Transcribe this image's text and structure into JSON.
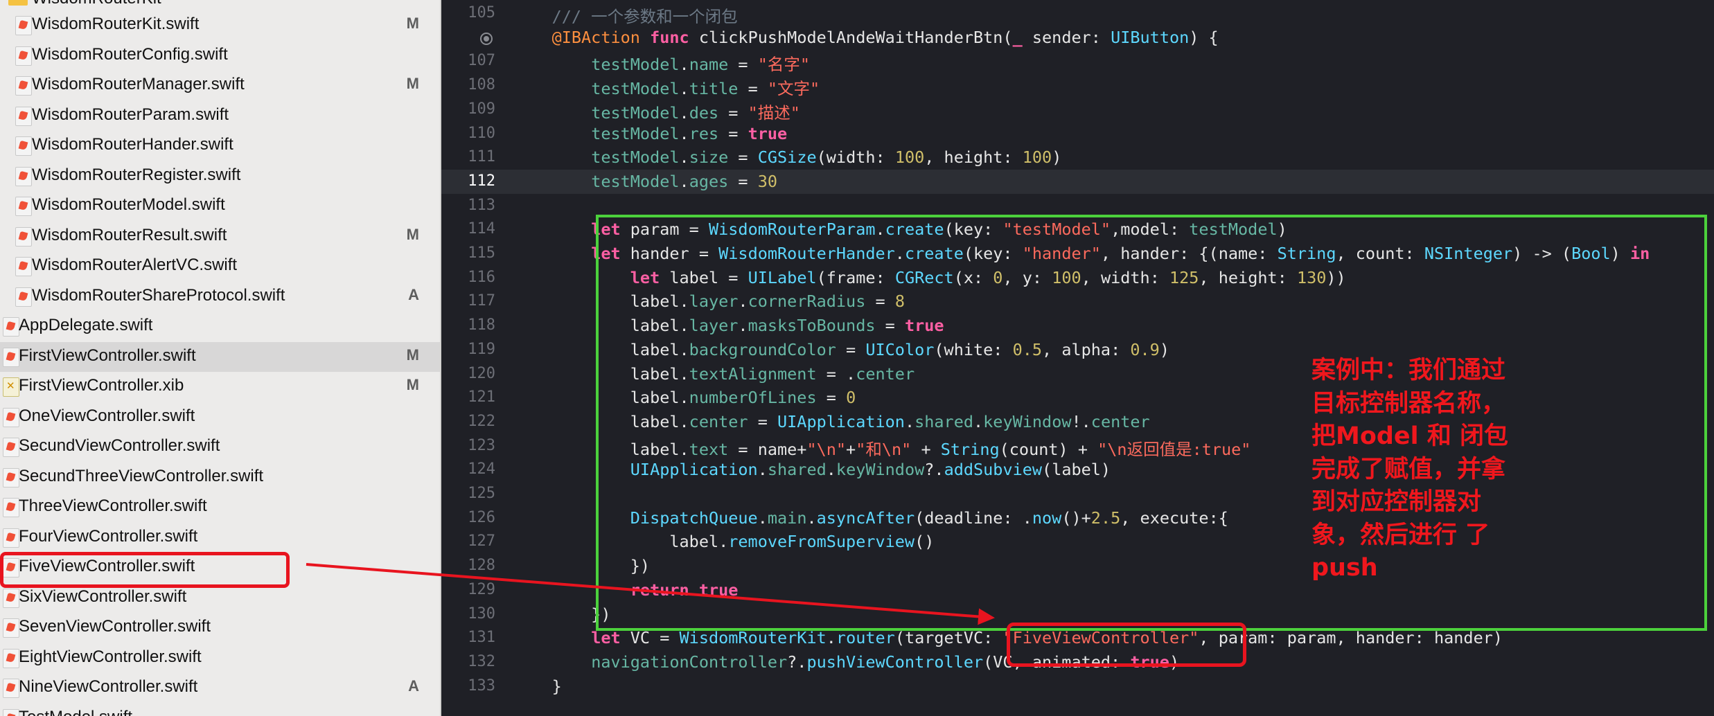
{
  "sidebar": {
    "folder_name": "WisdomRouterKit",
    "files": [
      {
        "name": "WisdomRouterKit.swift",
        "badge": "M",
        "type": "swift",
        "indent": 1
      },
      {
        "name": "WisdomRouterConfig.swift",
        "badge": "",
        "type": "swift",
        "indent": 1
      },
      {
        "name": "WisdomRouterManager.swift",
        "badge": "M",
        "type": "swift",
        "indent": 1
      },
      {
        "name": "WisdomRouterParam.swift",
        "badge": "",
        "type": "swift",
        "indent": 1
      },
      {
        "name": "WisdomRouterHander.swift",
        "badge": "",
        "type": "swift",
        "indent": 1
      },
      {
        "name": "WisdomRouterRegister.swift",
        "badge": "",
        "type": "swift",
        "indent": 1
      },
      {
        "name": "WisdomRouterModel.swift",
        "badge": "",
        "type": "swift",
        "indent": 1
      },
      {
        "name": "WisdomRouterResult.swift",
        "badge": "M",
        "type": "swift",
        "indent": 1
      },
      {
        "name": "WisdomRouterAlertVC.swift",
        "badge": "",
        "type": "swift",
        "indent": 1
      },
      {
        "name": "WisdomRouterShareProtocol.swift",
        "badge": "A",
        "type": "swift",
        "indent": 1
      },
      {
        "name": "AppDelegate.swift",
        "badge": "",
        "type": "swift",
        "indent": 0
      },
      {
        "name": "FirstViewController.swift",
        "badge": "M",
        "type": "swift",
        "indent": 0,
        "selected": true
      },
      {
        "name": "FirstViewController.xib",
        "badge": "M",
        "type": "xib",
        "indent": 0
      },
      {
        "name": "OneViewController.swift",
        "badge": "",
        "type": "swift",
        "indent": 0
      },
      {
        "name": "SecundViewController.swift",
        "badge": "",
        "type": "swift",
        "indent": 0
      },
      {
        "name": "SecundThreeViewController.swift",
        "badge": "",
        "type": "swift",
        "indent": 0
      },
      {
        "name": "ThreeViewController.swift",
        "badge": "",
        "type": "swift",
        "indent": 0
      },
      {
        "name": "FourViewController.swift",
        "badge": "",
        "type": "swift",
        "indent": 0
      },
      {
        "name": "FiveViewController.swift",
        "badge": "",
        "type": "swift",
        "indent": 0
      },
      {
        "name": "SixViewController.swift",
        "badge": "",
        "type": "swift",
        "indent": 0
      },
      {
        "name": "SevenViewController.swift",
        "badge": "",
        "type": "swift",
        "indent": 0
      },
      {
        "name": "EightViewController.swift",
        "badge": "",
        "type": "swift",
        "indent": 0
      },
      {
        "name": "NineViewController.swift",
        "badge": "A",
        "type": "swift",
        "indent": 0
      },
      {
        "name": "TestModel.swift",
        "badge": "",
        "type": "swift",
        "indent": 0
      }
    ]
  },
  "editor": {
    "current_line": 112,
    "lines": [
      {
        "n": "105",
        "t": [
          [
            "    ",
            ""
          ],
          [
            "/// 一个参数和一个闭包",
            "cm"
          ]
        ]
      },
      {
        "n": "",
        "bp": true,
        "t": [
          [
            "    ",
            ""
          ],
          [
            "@IBAction",
            "at"
          ],
          [
            " ",
            ""
          ],
          [
            "func",
            "kw"
          ],
          [
            " clickPushModelAndeWaitHanderBtn(",
            ""
          ],
          [
            "_",
            "kw"
          ],
          [
            " sender: ",
            ""
          ],
          [
            "UIButton",
            "ty"
          ],
          [
            ") {",
            ""
          ]
        ]
      },
      {
        "n": "107",
        "t": [
          [
            "        ",
            ""
          ],
          [
            "testModel",
            "pr"
          ],
          [
            ".",
            ""
          ],
          [
            "name",
            "pr"
          ],
          [
            " = ",
            ""
          ],
          [
            "\"名字\"",
            "st"
          ]
        ]
      },
      {
        "n": "108",
        "t": [
          [
            "        ",
            ""
          ],
          [
            "testModel",
            "pr"
          ],
          [
            ".",
            ""
          ],
          [
            "title",
            "pr"
          ],
          [
            " = ",
            ""
          ],
          [
            "\"文字\"",
            "st"
          ]
        ]
      },
      {
        "n": "109",
        "t": [
          [
            "        ",
            ""
          ],
          [
            "testModel",
            "pr"
          ],
          [
            ".",
            ""
          ],
          [
            "des",
            "pr"
          ],
          [
            " = ",
            ""
          ],
          [
            "\"描述\"",
            "st"
          ]
        ]
      },
      {
        "n": "110",
        "t": [
          [
            "        ",
            ""
          ],
          [
            "testModel",
            "pr"
          ],
          [
            ".",
            ""
          ],
          [
            "res",
            "pr"
          ],
          [
            " = ",
            ""
          ],
          [
            "true",
            "kw"
          ]
        ]
      },
      {
        "n": "111",
        "t": [
          [
            "        ",
            ""
          ],
          [
            "testModel",
            "pr"
          ],
          [
            ".",
            ""
          ],
          [
            "size",
            "pr"
          ],
          [
            " = ",
            ""
          ],
          [
            "CGSize",
            "ty"
          ],
          [
            "(width: ",
            ""
          ],
          [
            "100",
            "nm"
          ],
          [
            ", height: ",
            ""
          ],
          [
            "100",
            "nm"
          ],
          [
            ")",
            ""
          ]
        ]
      },
      {
        "n": "112",
        "t": [
          [
            "        ",
            ""
          ],
          [
            "testModel",
            "pr"
          ],
          [
            ".",
            ""
          ],
          [
            "ages",
            "pr"
          ],
          [
            " = ",
            ""
          ],
          [
            "30",
            "nm"
          ]
        ]
      },
      {
        "n": "113",
        "t": [
          [
            "",
            ""
          ]
        ]
      },
      {
        "n": "114",
        "t": [
          [
            "        ",
            ""
          ],
          [
            "let",
            "kw"
          ],
          [
            " param = ",
            ""
          ],
          [
            "WisdomRouterParam",
            "ty"
          ],
          [
            ".",
            ""
          ],
          [
            "create",
            "ty"
          ],
          [
            "(key: ",
            ""
          ],
          [
            "\"testModel\"",
            "st"
          ],
          [
            ",model: ",
            ""
          ],
          [
            "testModel",
            "pr"
          ],
          [
            ")",
            ""
          ]
        ]
      },
      {
        "n": "115",
        "t": [
          [
            "        ",
            ""
          ],
          [
            "let",
            "kw"
          ],
          [
            " hander = ",
            ""
          ],
          [
            "WisdomRouterHander",
            "ty"
          ],
          [
            ".",
            ""
          ],
          [
            "create",
            "ty"
          ],
          [
            "(key: ",
            ""
          ],
          [
            "\"hander\"",
            "st"
          ],
          [
            ", hander: {(name: ",
            ""
          ],
          [
            "String",
            "ty"
          ],
          [
            ", count: ",
            ""
          ],
          [
            "NSInteger",
            "ty"
          ],
          [
            ") -> (",
            ""
          ],
          [
            "Bool",
            "ty"
          ],
          [
            ") ",
            ""
          ],
          [
            "in",
            "kw"
          ]
        ]
      },
      {
        "n": "116",
        "t": [
          [
            "            ",
            ""
          ],
          [
            "let",
            "kw"
          ],
          [
            " label = ",
            ""
          ],
          [
            "UILabel",
            "ty"
          ],
          [
            "(frame: ",
            ""
          ],
          [
            "CGRect",
            "ty"
          ],
          [
            "(x: ",
            ""
          ],
          [
            "0",
            "nm"
          ],
          [
            ", y: ",
            ""
          ],
          [
            "100",
            "nm"
          ],
          [
            ", width: ",
            ""
          ],
          [
            "125",
            "nm"
          ],
          [
            ", height: ",
            ""
          ],
          [
            "130",
            "nm"
          ],
          [
            "))",
            ""
          ]
        ]
      },
      {
        "n": "117",
        "t": [
          [
            "            label.",
            ""
          ],
          [
            "layer",
            "pr"
          ],
          [
            ".",
            ""
          ],
          [
            "cornerRadius",
            "pr"
          ],
          [
            " = ",
            ""
          ],
          [
            "8",
            "nm"
          ]
        ]
      },
      {
        "n": "118",
        "t": [
          [
            "            label.",
            ""
          ],
          [
            "layer",
            "pr"
          ],
          [
            ".",
            ""
          ],
          [
            "masksToBounds",
            "pr"
          ],
          [
            " = ",
            ""
          ],
          [
            "true",
            "kw"
          ]
        ]
      },
      {
        "n": "119",
        "t": [
          [
            "            label.",
            ""
          ],
          [
            "backgroundColor",
            "pr"
          ],
          [
            " = ",
            ""
          ],
          [
            "UIColor",
            "ty"
          ],
          [
            "(white: ",
            ""
          ],
          [
            "0.5",
            "nm"
          ],
          [
            ", alpha: ",
            ""
          ],
          [
            "0.9",
            "nm"
          ],
          [
            ")",
            ""
          ]
        ]
      },
      {
        "n": "120",
        "t": [
          [
            "            label.",
            ""
          ],
          [
            "textAlignment",
            "pr"
          ],
          [
            " = .",
            ""
          ],
          [
            "center",
            "pr"
          ]
        ]
      },
      {
        "n": "121",
        "t": [
          [
            "            label.",
            ""
          ],
          [
            "numberOfLines",
            "pr"
          ],
          [
            " = ",
            ""
          ],
          [
            "0",
            "nm"
          ]
        ]
      },
      {
        "n": "122",
        "t": [
          [
            "            label.",
            ""
          ],
          [
            "center",
            "pr"
          ],
          [
            " = ",
            ""
          ],
          [
            "UIApplication",
            "ty"
          ],
          [
            ".",
            ""
          ],
          [
            "shared",
            "pr"
          ],
          [
            ".",
            ""
          ],
          [
            "keyWindow",
            "pr"
          ],
          [
            "!.",
            ""
          ],
          [
            "center",
            "pr"
          ]
        ]
      },
      {
        "n": "123",
        "t": [
          [
            "            label.",
            ""
          ],
          [
            "text",
            "pr"
          ],
          [
            " = name+",
            ""
          ],
          [
            "\"\\n\"",
            "st"
          ],
          [
            "+",
            ""
          ],
          [
            "\"和\\n\"",
            "st"
          ],
          [
            " + ",
            ""
          ],
          [
            "String",
            "ty"
          ],
          [
            "(count) + ",
            ""
          ],
          [
            "\"\\n返回值是:true\"",
            "st"
          ]
        ]
      },
      {
        "n": "124",
        "t": [
          [
            "            ",
            ""
          ],
          [
            "UIApplication",
            "ty"
          ],
          [
            ".",
            ""
          ],
          [
            "shared",
            "pr"
          ],
          [
            ".",
            ""
          ],
          [
            "keyWindow",
            "pr"
          ],
          [
            "?.",
            ""
          ],
          [
            "addSubview",
            "ty"
          ],
          [
            "(label)",
            ""
          ]
        ]
      },
      {
        "n": "125",
        "t": [
          [
            "",
            ""
          ]
        ]
      },
      {
        "n": "126",
        "t": [
          [
            "            ",
            ""
          ],
          [
            "DispatchQueue",
            "ty"
          ],
          [
            ".",
            ""
          ],
          [
            "main",
            "pr"
          ],
          [
            ".",
            ""
          ],
          [
            "asyncAfter",
            "ty"
          ],
          [
            "(deadline: .",
            ""
          ],
          [
            "now",
            "ty"
          ],
          [
            "()+",
            ""
          ],
          [
            "2.5",
            "nm"
          ],
          [
            ", execute:{",
            ""
          ]
        ]
      },
      {
        "n": "127",
        "t": [
          [
            "                label.",
            ""
          ],
          [
            "removeFromSuperview",
            "ty"
          ],
          [
            "()",
            ""
          ]
        ]
      },
      {
        "n": "128",
        "t": [
          [
            "            })",
            ""
          ]
        ]
      },
      {
        "n": "129",
        "t": [
          [
            "            ",
            ""
          ],
          [
            "return",
            "kw"
          ],
          [
            " ",
            ""
          ],
          [
            "true",
            "kw"
          ]
        ]
      },
      {
        "n": "130",
        "t": [
          [
            "        })",
            ""
          ]
        ]
      },
      {
        "n": "131",
        "t": [
          [
            "        ",
            ""
          ],
          [
            "let",
            "kw"
          ],
          [
            " VC = ",
            ""
          ],
          [
            "WisdomRouterKit",
            "ty"
          ],
          [
            ".",
            ""
          ],
          [
            "router",
            "ty"
          ],
          [
            "(targetVC: ",
            ""
          ],
          [
            "\"FiveViewController\"",
            "st"
          ],
          [
            ", param: param, hander: hander)",
            ""
          ]
        ]
      },
      {
        "n": "132",
        "t": [
          [
            "        ",
            ""
          ],
          [
            "navigationController",
            "pr"
          ],
          [
            "?.",
            ""
          ],
          [
            "pushViewController",
            "ty"
          ],
          [
            "(VC, animated: ",
            ""
          ],
          [
            "true",
            "kw"
          ],
          [
            ")",
            ""
          ]
        ]
      },
      {
        "n": "133",
        "t": [
          [
            "    }",
            ""
          ]
        ]
      }
    ]
  },
  "annotation": {
    "lines": [
      "案例中：我们通过",
      "目标控制器名称，",
      "把Model 和 闭包",
      "完成了赋值，并拿",
      "到对应控制器对",
      "象，然后进行 了",
      "push"
    ],
    "color": "#f0171d"
  },
  "colors": {
    "highlight_green": "#4cd13c",
    "highlight_red": "#e8141f",
    "editor_bg": "#1f2026",
    "sidebar_bg": "#ecebea"
  }
}
